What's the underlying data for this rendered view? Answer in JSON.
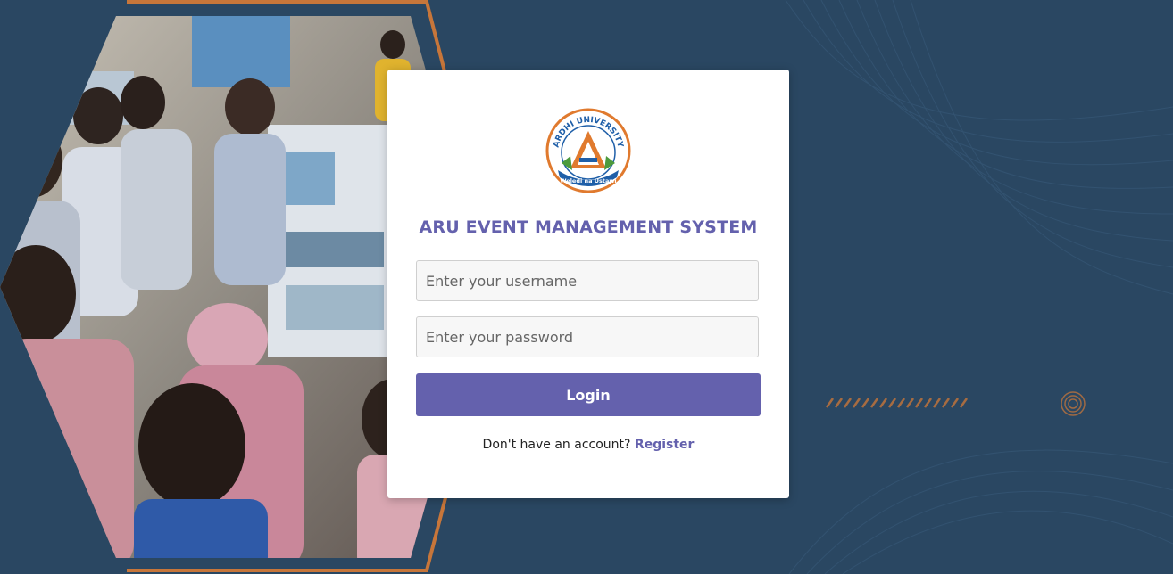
{
  "login_card": {
    "logo": {
      "top_text": "ARDHI UNIVERSITY",
      "ribbon_text": "Weledi na Ustawi",
      "colors": {
        "orange": "#e07a2e",
        "blue": "#1f5fa8",
        "green": "#4c9a3c"
      }
    },
    "title": "ARU EVENT MANAGEMENT SYSTEM",
    "username": {
      "placeholder": "Enter your username",
      "value": ""
    },
    "password": {
      "placeholder": "Enter your password",
      "value": ""
    },
    "login_label": "Login",
    "register_prompt": "Don't have an account?",
    "register_link": "Register"
  },
  "colors": {
    "background": "#2a4762",
    "accent": "#6461ad",
    "frame_orange": "#c7763a"
  }
}
